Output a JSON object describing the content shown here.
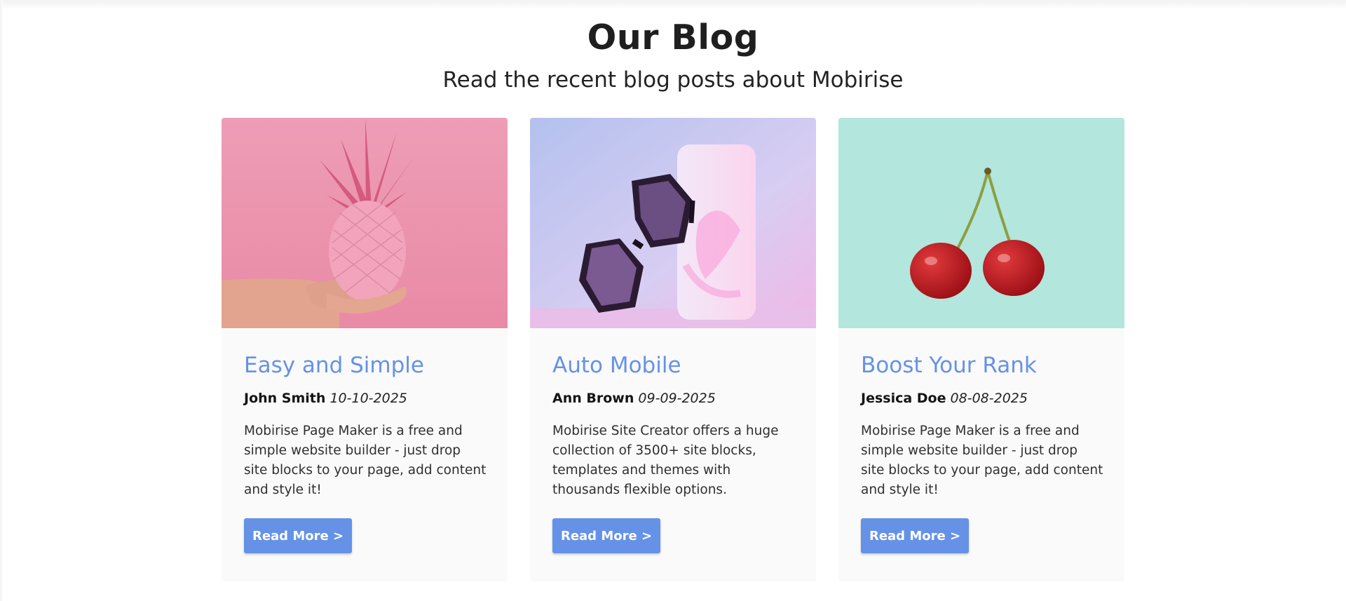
{
  "header": {
    "title": "Our Blog",
    "subtitle": "Read the recent blog posts about Mobirise"
  },
  "theme": {
    "accent": "#6592e6",
    "card_background": "#fafafa"
  },
  "posts": [
    {
      "image": "pink-pineapple-in-hand-photo",
      "title": "Easy and Simple",
      "author": "John Smith",
      "date": "10-10-2025",
      "text": "Mobirise Page Maker is a free and simple website builder - just drop site blocks to your page, add content and style it!",
      "button_label": "Read More >"
    },
    {
      "image": "sunglasses-and-pink-box-photo",
      "title": "Auto Mobile",
      "author": "Ann Brown",
      "date": "09-09-2025",
      "text": "Mobirise Site Creator offers a huge collection of 3500+ site blocks, templates and themes with thousands flexible options.",
      "button_label": "Read More >"
    },
    {
      "image": "two-cherries-photo",
      "title": "Boost Your Rank",
      "author": "Jessica Doe",
      "date": "08-08-2025",
      "text": "Mobirise Page Maker is a free and simple website builder - just drop site blocks to your page, add content and style it!",
      "button_label": "Read More >"
    }
  ]
}
